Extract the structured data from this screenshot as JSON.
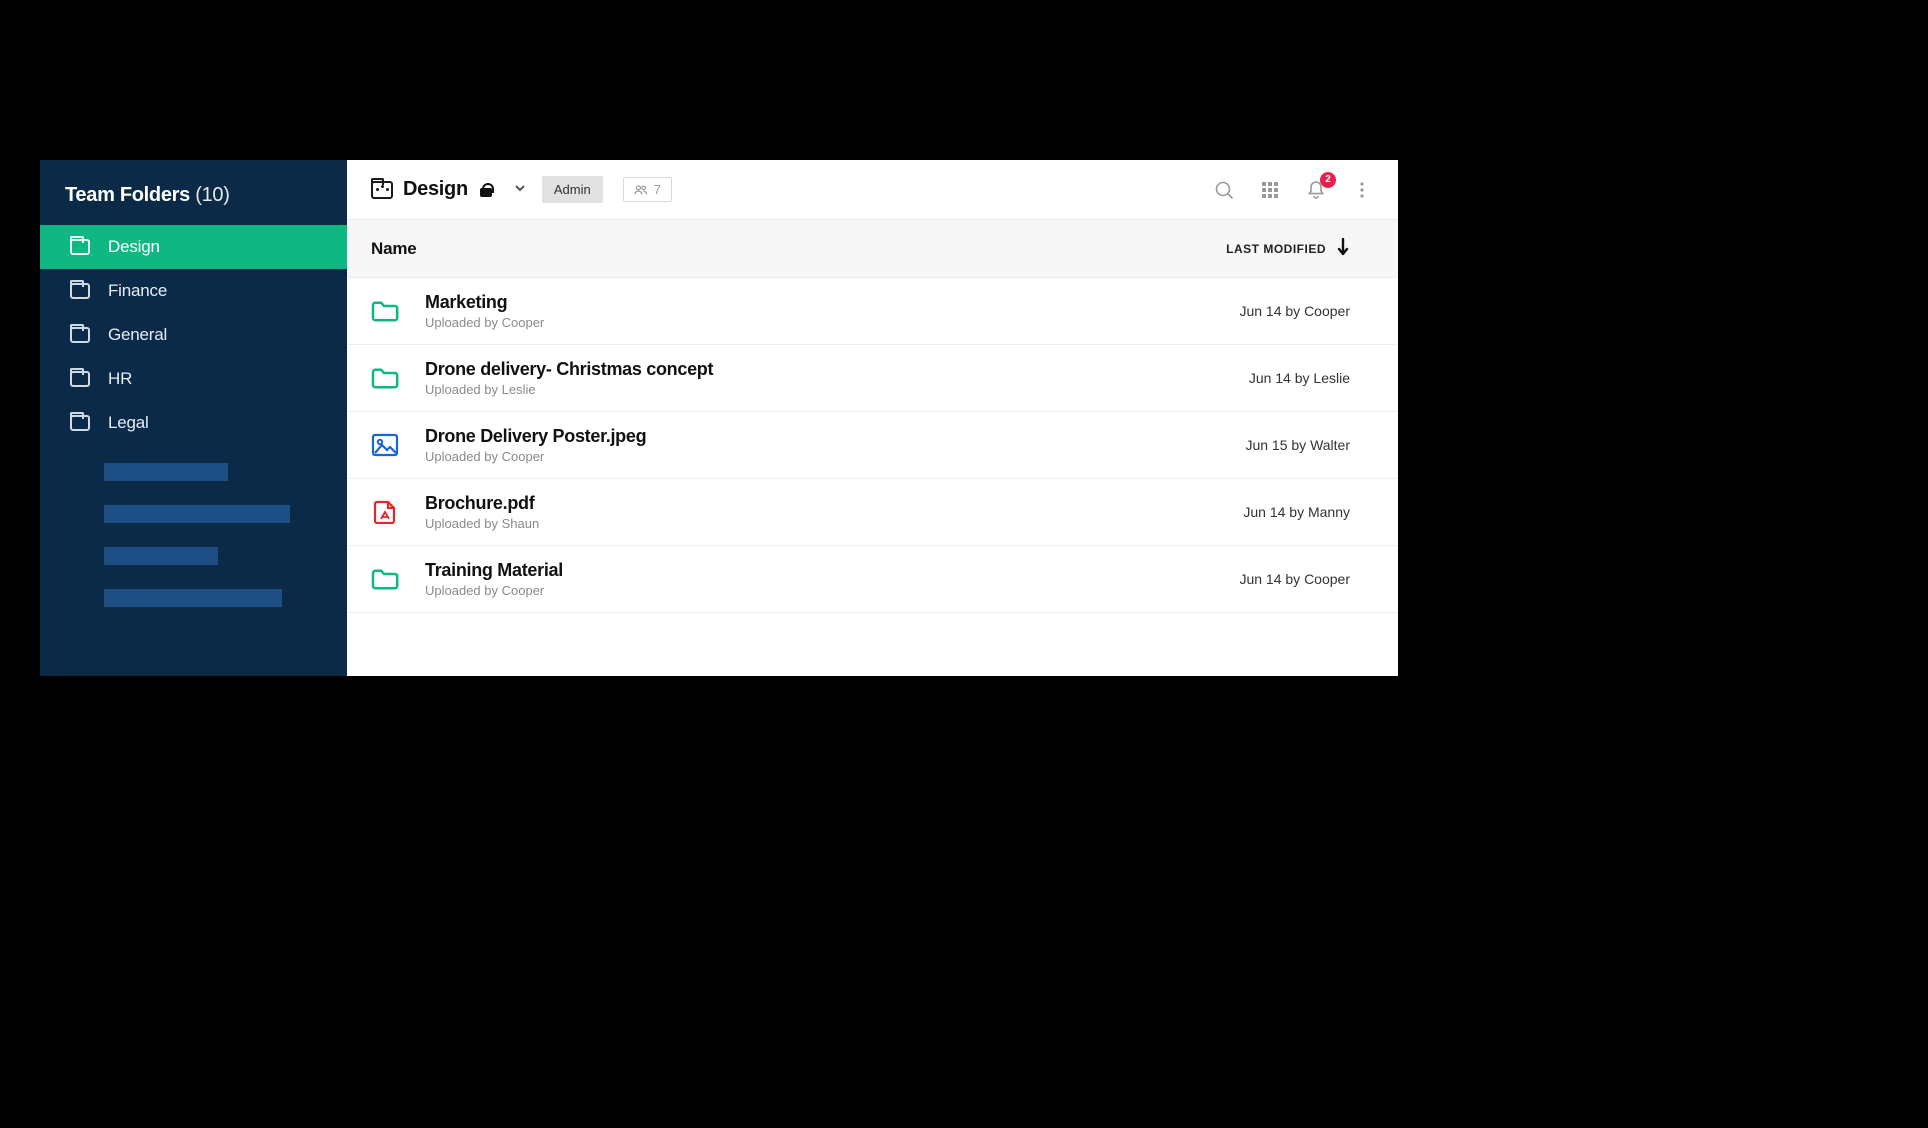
{
  "sidebar": {
    "title": "Team Folders",
    "count": "(10)",
    "items": [
      {
        "label": "Design",
        "active": true
      },
      {
        "label": "Finance",
        "active": false
      },
      {
        "label": "General",
        "active": false
      },
      {
        "label": "HR",
        "active": false
      },
      {
        "label": "Legal",
        "active": false
      }
    ]
  },
  "header": {
    "folder_name": "Design",
    "role_label": "Admin",
    "member_count": "7",
    "notification_count": "2",
    "columns": {
      "name": "Name",
      "modified": "LAST MODIFIED"
    }
  },
  "rows": [
    {
      "icon": "folder",
      "title": "Marketing",
      "subtitle": "Uploaded by Cooper",
      "modified": "Jun 14 by Cooper"
    },
    {
      "icon": "folder",
      "title": "Drone delivery- Christmas concept",
      "subtitle": "Uploaded by Leslie",
      "modified": "Jun 14 by Leslie"
    },
    {
      "icon": "image",
      "title": "Drone Delivery Poster.jpeg",
      "subtitle": "Uploaded by Cooper",
      "modified": "Jun 15 by Walter"
    },
    {
      "icon": "pdf",
      "title": "Brochure.pdf",
      "subtitle": "Uploaded by Shaun",
      "modified": "Jun 14 by Manny"
    },
    {
      "icon": "folder",
      "title": "Training Material",
      "subtitle": "Uploaded by Cooper",
      "modified": "Jun 14 by Cooper"
    }
  ]
}
